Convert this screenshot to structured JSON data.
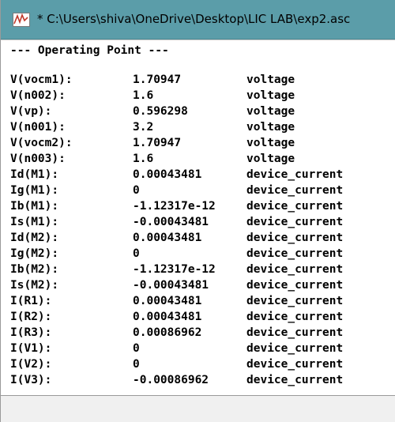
{
  "window": {
    "title": "* C:\\Users\\shiva\\OneDrive\\Desktop\\LIC LAB\\exp2.asc",
    "icon": "ltspice-waveform-icon",
    "titlebar_color": "#5b9da9"
  },
  "report": {
    "heading": "--- Operating Point ---",
    "rows": [
      {
        "name": "V(vocm1):",
        "value": "1.70947",
        "kind": "voltage"
      },
      {
        "name": "V(n002):",
        "value": "1.6",
        "kind": "voltage"
      },
      {
        "name": "V(vp):",
        "value": "0.596298",
        "kind": "voltage"
      },
      {
        "name": "V(n001):",
        "value": "3.2",
        "kind": "voltage"
      },
      {
        "name": "V(vocm2):",
        "value": "1.70947",
        "kind": "voltage"
      },
      {
        "name": "V(n003):",
        "value": "1.6",
        "kind": "voltage"
      },
      {
        "name": "Id(M1):",
        "value": "0.00043481",
        "kind": "device_current"
      },
      {
        "name": "Ig(M1):",
        "value": "0",
        "kind": "device_current"
      },
      {
        "name": "Ib(M1):",
        "value": "-1.12317e-12",
        "kind": "device_current"
      },
      {
        "name": "Is(M1):",
        "value": "-0.00043481",
        "kind": "device_current"
      },
      {
        "name": "Id(M2):",
        "value": "0.00043481",
        "kind": "device_current"
      },
      {
        "name": "Ig(M2):",
        "value": "0",
        "kind": "device_current"
      },
      {
        "name": "Ib(M2):",
        "value": "-1.12317e-12",
        "kind": "device_current"
      },
      {
        "name": "Is(M2):",
        "value": "-0.00043481",
        "kind": "device_current"
      },
      {
        "name": "I(R1):",
        "value": "0.00043481",
        "kind": "device_current"
      },
      {
        "name": "I(R2):",
        "value": "0.00043481",
        "kind": "device_current"
      },
      {
        "name": "I(R3):",
        "value": "0.00086962",
        "kind": "device_current"
      },
      {
        "name": "I(V1):",
        "value": "0",
        "kind": "device_current"
      },
      {
        "name": "I(V2):",
        "value": "0",
        "kind": "device_current"
      },
      {
        "name": "I(V3):",
        "value": "-0.00086962",
        "kind": "device_current"
      }
    ]
  }
}
